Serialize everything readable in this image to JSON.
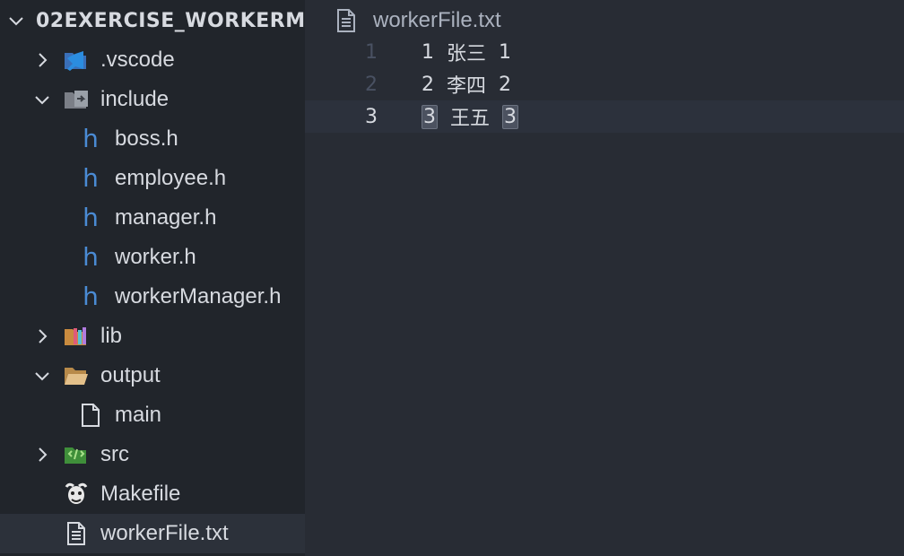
{
  "explorer": {
    "title": "02EXERCISE_WORKERM...",
    "items": [
      {
        "label": ".vscode",
        "icon": "vscode-folder-icon",
        "expanded": false
      },
      {
        "label": "include",
        "icon": "include-folder-icon",
        "expanded": true
      },
      {
        "label": "boss.h",
        "icon": "h-file-icon"
      },
      {
        "label": "employee.h",
        "icon": "h-file-icon"
      },
      {
        "label": "manager.h",
        "icon": "h-file-icon"
      },
      {
        "label": "worker.h",
        "icon": "h-file-icon"
      },
      {
        "label": "workerManager.h",
        "icon": "h-file-icon"
      },
      {
        "label": "lib",
        "icon": "lib-folder-icon",
        "expanded": false
      },
      {
        "label": "output",
        "icon": "folder-open-icon",
        "expanded": true
      },
      {
        "label": "main",
        "icon": "file-icon"
      },
      {
        "label": "src",
        "icon": "src-folder-icon",
        "expanded": false
      },
      {
        "label": "Makefile",
        "icon": "gnu-makefile-icon"
      },
      {
        "label": "workerFile.txt",
        "icon": "text-file-icon",
        "selected": true
      }
    ]
  },
  "editor": {
    "tab": {
      "label": "workerFile.txt",
      "icon": "text-file-icon"
    },
    "lines": [
      {
        "number": "1",
        "id": "1",
        "name": "张三",
        "dept": "1"
      },
      {
        "number": "2",
        "id": "2",
        "name": "李四",
        "dept": "2"
      },
      {
        "number": "3",
        "id": "3",
        "name": "王五",
        "dept": "3",
        "current": true
      }
    ]
  },
  "colors": {
    "sidebar_bg": "#21252b",
    "editor_bg": "#282c34",
    "selected_row": "#2c313a",
    "h_icon": "#4a8bd4"
  }
}
